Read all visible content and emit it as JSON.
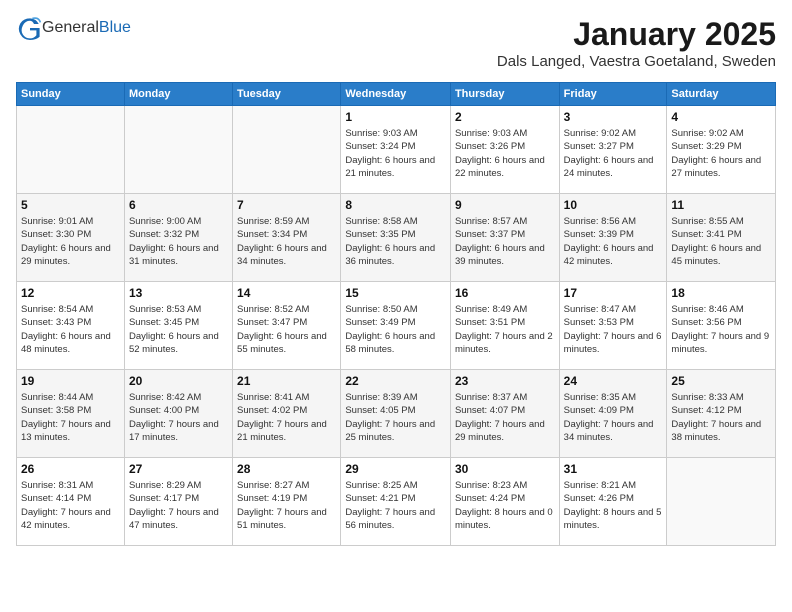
{
  "logo": {
    "general": "General",
    "blue": "Blue"
  },
  "header": {
    "title": "January 2025",
    "subtitle": "Dals Langed, Vaestra Goetaland, Sweden"
  },
  "weekdays": [
    "Sunday",
    "Monday",
    "Tuesday",
    "Wednesday",
    "Thursday",
    "Friday",
    "Saturday"
  ],
  "days": [
    {
      "number": "",
      "info": ""
    },
    {
      "number": "",
      "info": ""
    },
    {
      "number": "",
      "info": ""
    },
    {
      "number": "1",
      "info": "Sunrise: 9:03 AM\nSunset: 3:24 PM\nDaylight: 6 hours and 21 minutes."
    },
    {
      "number": "2",
      "info": "Sunrise: 9:03 AM\nSunset: 3:26 PM\nDaylight: 6 hours and 22 minutes."
    },
    {
      "number": "3",
      "info": "Sunrise: 9:02 AM\nSunset: 3:27 PM\nDaylight: 6 hours and 24 minutes."
    },
    {
      "number": "4",
      "info": "Sunrise: 9:02 AM\nSunset: 3:29 PM\nDaylight: 6 hours and 27 minutes."
    },
    {
      "number": "5",
      "info": "Sunrise: 9:01 AM\nSunset: 3:30 PM\nDaylight: 6 hours and 29 minutes."
    },
    {
      "number": "6",
      "info": "Sunrise: 9:00 AM\nSunset: 3:32 PM\nDaylight: 6 hours and 31 minutes."
    },
    {
      "number": "7",
      "info": "Sunrise: 8:59 AM\nSunset: 3:34 PM\nDaylight: 6 hours and 34 minutes."
    },
    {
      "number": "8",
      "info": "Sunrise: 8:58 AM\nSunset: 3:35 PM\nDaylight: 6 hours and 36 minutes."
    },
    {
      "number": "9",
      "info": "Sunrise: 8:57 AM\nSunset: 3:37 PM\nDaylight: 6 hours and 39 minutes."
    },
    {
      "number": "10",
      "info": "Sunrise: 8:56 AM\nSunset: 3:39 PM\nDaylight: 6 hours and 42 minutes."
    },
    {
      "number": "11",
      "info": "Sunrise: 8:55 AM\nSunset: 3:41 PM\nDaylight: 6 hours and 45 minutes."
    },
    {
      "number": "12",
      "info": "Sunrise: 8:54 AM\nSunset: 3:43 PM\nDaylight: 6 hours and 48 minutes."
    },
    {
      "number": "13",
      "info": "Sunrise: 8:53 AM\nSunset: 3:45 PM\nDaylight: 6 hours and 52 minutes."
    },
    {
      "number": "14",
      "info": "Sunrise: 8:52 AM\nSunset: 3:47 PM\nDaylight: 6 hours and 55 minutes."
    },
    {
      "number": "15",
      "info": "Sunrise: 8:50 AM\nSunset: 3:49 PM\nDaylight: 6 hours and 58 minutes."
    },
    {
      "number": "16",
      "info": "Sunrise: 8:49 AM\nSunset: 3:51 PM\nDaylight: 7 hours and 2 minutes."
    },
    {
      "number": "17",
      "info": "Sunrise: 8:47 AM\nSunset: 3:53 PM\nDaylight: 7 hours and 6 minutes."
    },
    {
      "number": "18",
      "info": "Sunrise: 8:46 AM\nSunset: 3:56 PM\nDaylight: 7 hours and 9 minutes."
    },
    {
      "number": "19",
      "info": "Sunrise: 8:44 AM\nSunset: 3:58 PM\nDaylight: 7 hours and 13 minutes."
    },
    {
      "number": "20",
      "info": "Sunrise: 8:42 AM\nSunset: 4:00 PM\nDaylight: 7 hours and 17 minutes."
    },
    {
      "number": "21",
      "info": "Sunrise: 8:41 AM\nSunset: 4:02 PM\nDaylight: 7 hours and 21 minutes."
    },
    {
      "number": "22",
      "info": "Sunrise: 8:39 AM\nSunset: 4:05 PM\nDaylight: 7 hours and 25 minutes."
    },
    {
      "number": "23",
      "info": "Sunrise: 8:37 AM\nSunset: 4:07 PM\nDaylight: 7 hours and 29 minutes."
    },
    {
      "number": "24",
      "info": "Sunrise: 8:35 AM\nSunset: 4:09 PM\nDaylight: 7 hours and 34 minutes."
    },
    {
      "number": "25",
      "info": "Sunrise: 8:33 AM\nSunset: 4:12 PM\nDaylight: 7 hours and 38 minutes."
    },
    {
      "number": "26",
      "info": "Sunrise: 8:31 AM\nSunset: 4:14 PM\nDaylight: 7 hours and 42 minutes."
    },
    {
      "number": "27",
      "info": "Sunrise: 8:29 AM\nSunset: 4:17 PM\nDaylight: 7 hours and 47 minutes."
    },
    {
      "number": "28",
      "info": "Sunrise: 8:27 AM\nSunset: 4:19 PM\nDaylight: 7 hours and 51 minutes."
    },
    {
      "number": "29",
      "info": "Sunrise: 8:25 AM\nSunset: 4:21 PM\nDaylight: 7 hours and 56 minutes."
    },
    {
      "number": "30",
      "info": "Sunrise: 8:23 AM\nSunset: 4:24 PM\nDaylight: 8 hours and 0 minutes."
    },
    {
      "number": "31",
      "info": "Sunrise: 8:21 AM\nSunset: 4:26 PM\nDaylight: 8 hours and 5 minutes."
    },
    {
      "number": "",
      "info": ""
    }
  ]
}
